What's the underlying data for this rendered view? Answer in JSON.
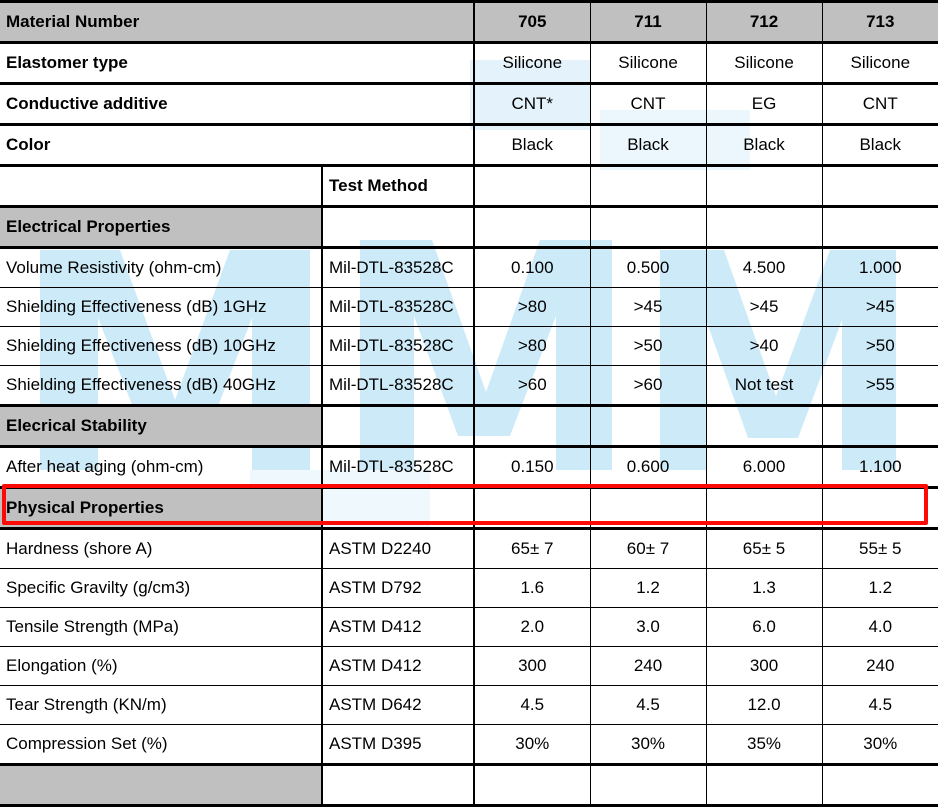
{
  "table": {
    "material_number_label": "Material Number",
    "test_method_header": "Test Method",
    "columns": [
      "705",
      "711",
      "712",
      "713"
    ],
    "intro_rows": [
      {
        "label": "Elastomer type",
        "values": [
          "Silicone",
          "Silicone",
          "Silicone",
          "Silicone"
        ]
      },
      {
        "label": "Conductive additive",
        "values": [
          "CNT*",
          "CNT",
          "EG",
          "CNT"
        ]
      },
      {
        "label": "Color",
        "values": [
          "Black",
          "Black",
          "Black",
          "Black"
        ]
      }
    ],
    "sections": [
      {
        "title": "Electrical Properties",
        "rows": [
          {
            "label": "Volume Resistivity (ohm-cm)",
            "method": "Mil-DTL-83528C",
            "values": [
              "0.100",
              "0.500",
              "4.500",
              "1.000"
            ]
          },
          {
            "label": "Shielding Effectiveness (dB) 1GHz",
            "method": "Mil-DTL-83528C",
            "values": [
              ">80",
              ">45",
              ">45",
              ">45"
            ]
          },
          {
            "label": "Shielding Effectiveness (dB) 10GHz",
            "method": "Mil-DTL-83528C",
            "values": [
              ">80",
              ">50",
              ">40",
              ">50"
            ]
          },
          {
            "label": "Shielding Effectiveness (dB) 40GHz",
            "method": "Mil-DTL-83528C",
            "values": [
              ">60",
              ">60",
              "Not test",
              ">55"
            ]
          }
        ]
      },
      {
        "title": "Elecrical Stability",
        "rows": [
          {
            "label": "After heat aging (ohm-cm)",
            "method": "Mil-DTL-83528C",
            "values": [
              "0.150",
              "0.600",
              "6.000",
              "1.100"
            ]
          }
        ]
      },
      {
        "title": "Physical Properties",
        "rows": [
          {
            "label": "Hardness (shore A)",
            "method": "ASTM D2240",
            "values": [
              "65± 7",
              "60± 7",
              "65± 5",
              "55± 5"
            ],
            "highlighted": true
          },
          {
            "label": "Specific Gravilty  (g/cm3)",
            "method": "ASTM D792",
            "values": [
              "1.6",
              "1.2",
              "1.3",
              "1.2"
            ]
          },
          {
            "label": "Tensile Strength (MPa)",
            "method": "ASTM D412",
            "values": [
              "2.0",
              "3.0",
              "6.0",
              "4.0"
            ]
          },
          {
            "label": "Elongation (%)",
            "method": "ASTM D412",
            "values": [
              "300",
              "240",
              "300",
              "240"
            ]
          },
          {
            "label": "Tear Strength (KN/m)",
            "method": "ASTM D642",
            "values": [
              "4.5",
              "4.5",
              "12.0",
              "4.5"
            ]
          },
          {
            "label": "Compression Set (%)",
            "method": "ASTM D395",
            "values": [
              "30%",
              "30%",
              "35%",
              "30%"
            ]
          }
        ]
      },
      {
        "title": "",
        "rows": []
      }
    ]
  },
  "colors": {
    "section_header_fill": "#c0c0c0",
    "highlight_border": "#fb0a06",
    "watermark": "#cdeaf8",
    "rule": "#000000"
  }
}
